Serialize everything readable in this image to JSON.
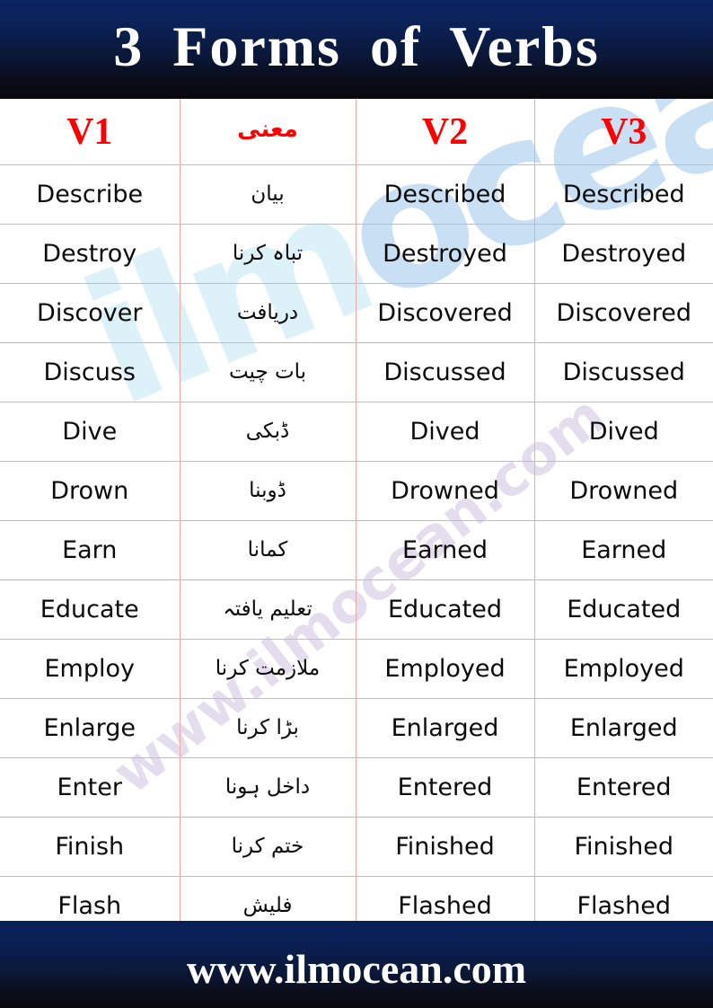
{
  "header": {
    "title": "3 Forms of Verbs",
    "background_color": "#0a2463"
  },
  "table": {
    "columns": [
      {
        "key": "v1",
        "label": "V1",
        "lang": "en"
      },
      {
        "key": "meaning",
        "label": "معنی",
        "lang": "ur"
      },
      {
        "key": "v2",
        "label": "V2",
        "lang": "en"
      },
      {
        "key": "v3",
        "label": "V3",
        "lang": "en"
      }
    ],
    "header_color": "#fe0000",
    "gridline_color": "#f4a6a6",
    "rows": [
      {
        "v1": "Describe",
        "meaning": "بیان",
        "v2": "Described",
        "v3": "Described"
      },
      {
        "v1": "Destroy",
        "meaning": "تباہ کرنا",
        "v2": "Destroyed",
        "v3": "Destroyed"
      },
      {
        "v1": "Discover",
        "meaning": "دریافت",
        "v2": "Discovered",
        "v3": "Discovered"
      },
      {
        "v1": "Discuss",
        "meaning": "بات چیت",
        "v2": "Discussed",
        "v3": "Discussed"
      },
      {
        "v1": "Dive",
        "meaning": "ڈبکی",
        "v2": "Dived",
        "v3": "Dived"
      },
      {
        "v1": "Drown",
        "meaning": "ڈوبنا",
        "v2": "Drowned",
        "v3": "Drowned"
      },
      {
        "v1": "Earn",
        "meaning": "کمانا",
        "v2": "Earned",
        "v3": "Earned"
      },
      {
        "v1": "Educate",
        "meaning": "تعلیم یافتہ",
        "v2": "Educated",
        "v3": "Educated"
      },
      {
        "v1": "Employ",
        "meaning": "ملازمت کرنا",
        "v2": "Employed",
        "v3": "Employed"
      },
      {
        "v1": "Enlarge",
        "meaning": "بڑا کرنا",
        "v2": "Enlarged",
        "v3": "Enlarged"
      },
      {
        "v1": "Enter",
        "meaning": "داخل ہونا",
        "v2": "Entered",
        "v3": "Entered"
      },
      {
        "v1": "Finish",
        "meaning": "ختم کرنا",
        "v2": "Finished",
        "v3": "Finished"
      },
      {
        "v1": "Flash",
        "meaning": "فلیش",
        "v2": "Flashed",
        "v3": "Flashed"
      }
    ]
  },
  "watermark": {
    "logo_text": "ilmocean",
    "logo_part_one": "ilm",
    "logo_part_two": "ocean",
    "url_text": "www.ilmocean.com",
    "logo_color": "#cfeaf3",
    "url_color": "#e2dcee"
  },
  "footer": {
    "url": "www.ilmocean.com",
    "background_color": "#072157"
  }
}
